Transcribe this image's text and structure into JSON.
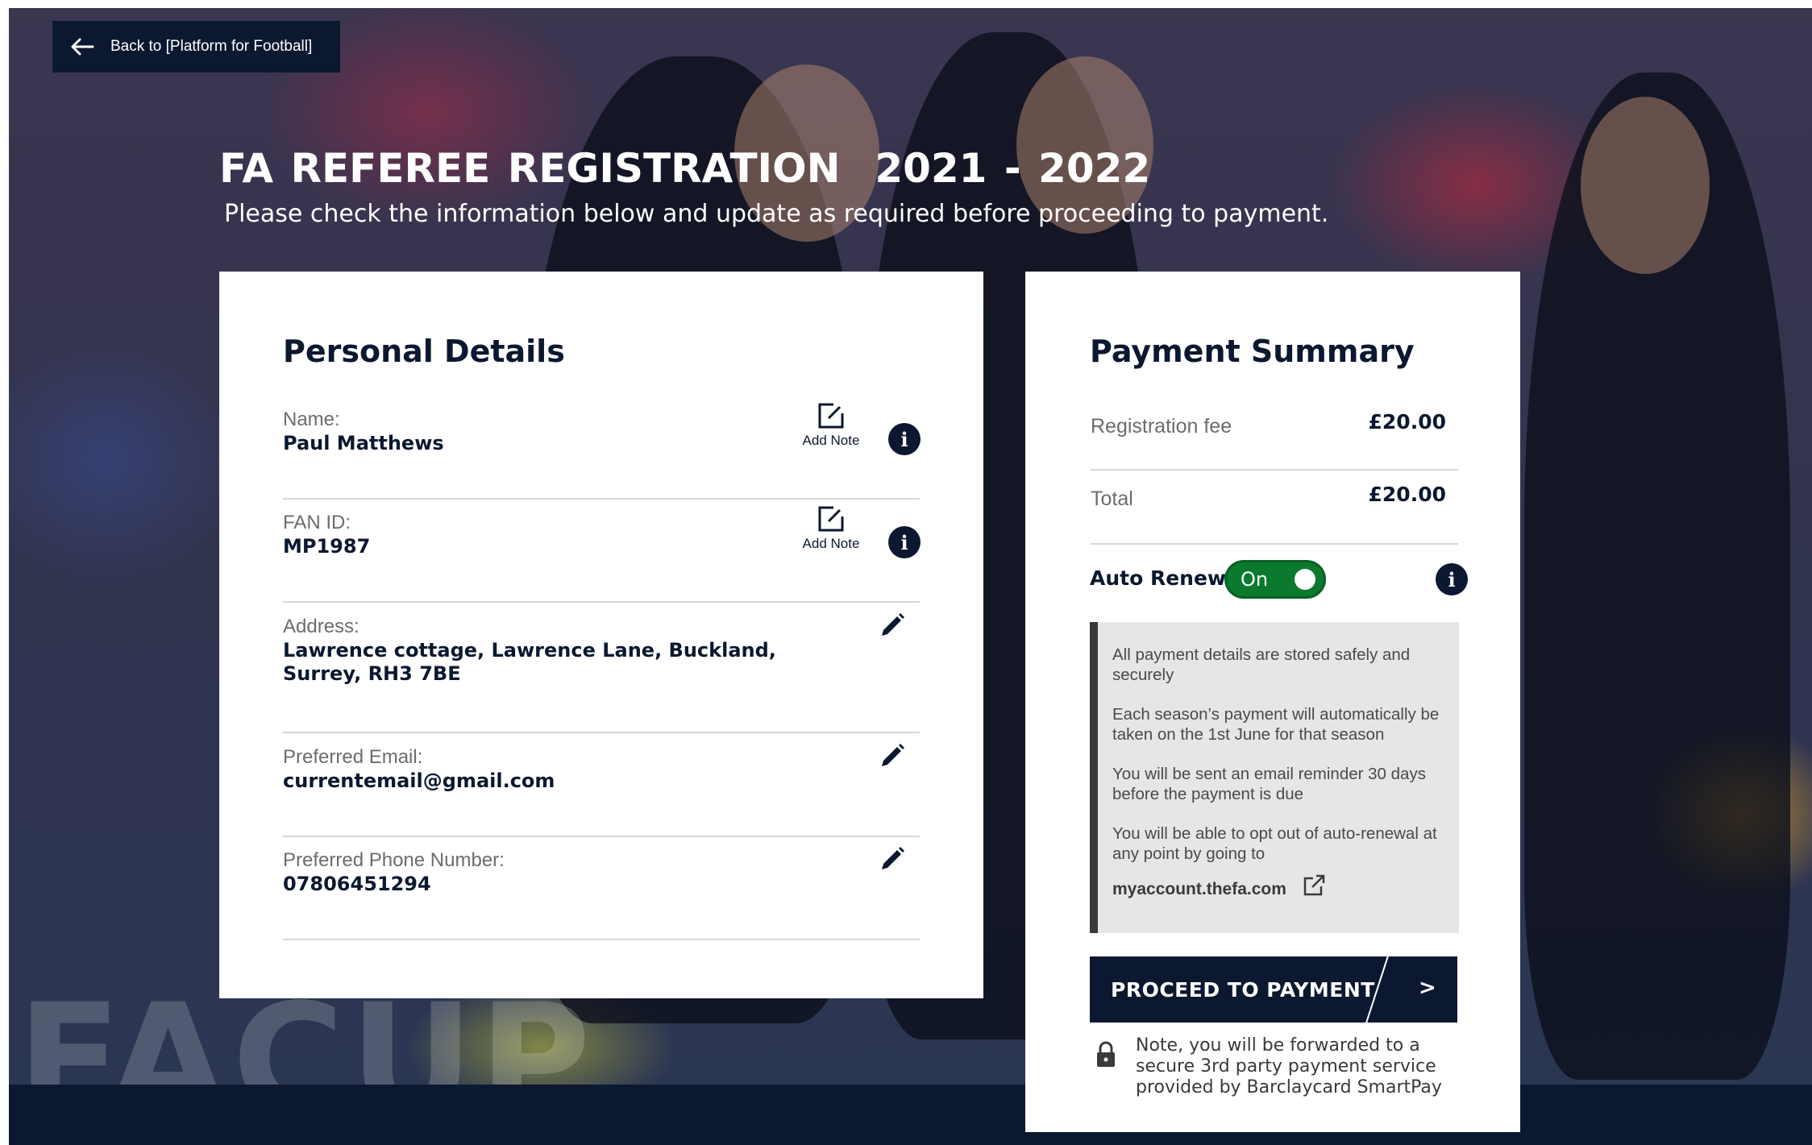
{
  "header": {
    "back_label": "Back to [Platform for Football]",
    "title": "FA REFEREE REGISTRATION  2021 - 2022",
    "subtitle": "Please check the information below and update as required before proceeding to payment."
  },
  "personal": {
    "heading": "Personal Details",
    "add_note_label": "Add Note",
    "fields": [
      {
        "label": "Name:",
        "value": "Paul Matthews"
      },
      {
        "label": "FAN ID:",
        "value": "MP1987"
      },
      {
        "label": "Address:",
        "value": "Lawrence cottage, Lawrence Lane, Buckland, Surrey, RH3 7BE"
      },
      {
        "label": "Preferred Email:",
        "value": "currentemail@gmail.com"
      },
      {
        "label": "Preferred Phone Number:",
        "value": "07806451294"
      }
    ]
  },
  "payment": {
    "heading": "Payment Summary",
    "rows": [
      {
        "label": "Registration fee",
        "value": "£20.00"
      },
      {
        "label": "Total",
        "value": "£20.00"
      }
    ],
    "auto_renew": {
      "label": "Auto Renew",
      "state": "On"
    },
    "notice": [
      "All payment details are stored safely and securely",
      "Each season’s payment will automatically be taken on the 1st June for that season",
      "You will be sent an email reminder 30 days before the payment is due",
      "You will be able to opt out of auto-renewal at any point by going to"
    ],
    "notice_link": "myaccount.thefa.com",
    "proceed_label": "PROCEED TO PAYMENT",
    "proceed_chevron": ">",
    "secure_note": "Note, you will be forwarded to a secure 3rd party payment service provided by Barclaycard SmartPay"
  },
  "colors": {
    "navy": "#0c1830",
    "toggle_on": "#0b7a2e",
    "notice_bg": "#e6e6e6"
  },
  "icons": [
    "arrow-left-icon",
    "edit-note-icon",
    "info-icon",
    "pencil-icon",
    "external-link-icon",
    "lock-icon"
  ]
}
